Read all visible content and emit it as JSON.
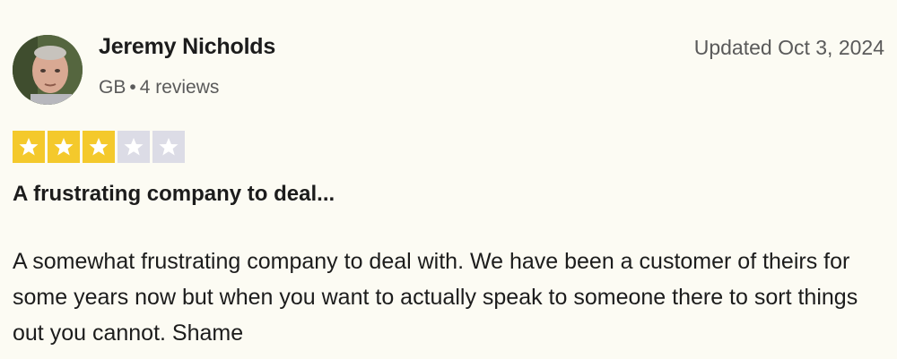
{
  "reviewer": {
    "name": "Jeremy Nicholds",
    "country": "GB",
    "separator": "•",
    "reviews_count": "4 reviews"
  },
  "review": {
    "date": "Updated Oct 3, 2024",
    "rating": 3,
    "max_rating": 5,
    "title": "A frustrating company to deal...",
    "body": "A somewhat frustrating company to deal with. We have been a customer of theirs for some years now but when you want to actually speak to someone there to sort things out you cannot. Shame"
  },
  "colors": {
    "star_filled": "#f4c92c",
    "star_empty": "#dcdce6",
    "background": "#fcfbf3"
  }
}
